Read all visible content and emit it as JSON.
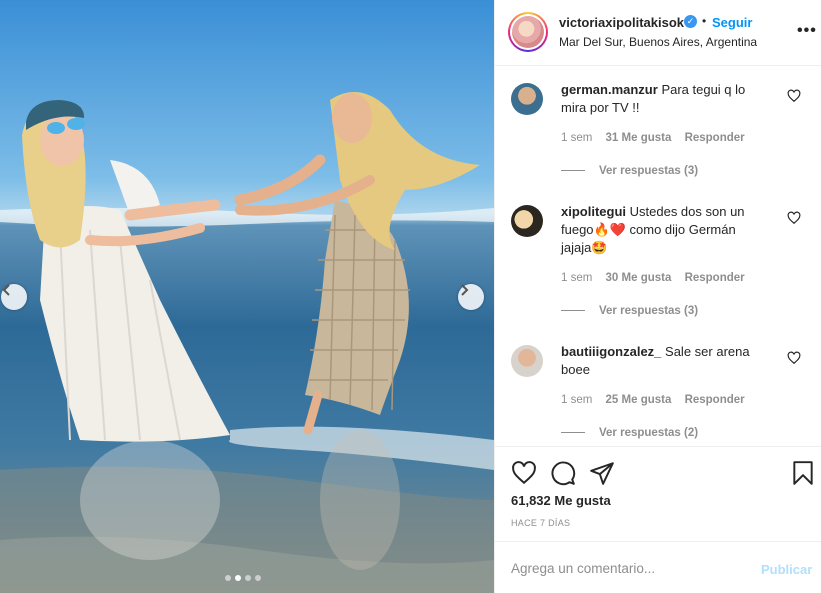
{
  "post": {
    "username": "victoriaxipolitakisok",
    "follow_label": "Seguir",
    "separator": "•",
    "location": "Mar Del Sur, Buenos Aires, Argentina",
    "more_icon": "•••",
    "likes": "61,832 Me gusta",
    "time_ago": "HACE 7 DÍAS",
    "carousel": {
      "total": 4,
      "active_index": 1
    }
  },
  "comments": [
    {
      "user": "german.manzur",
      "text": "Para tegui q lo mira por TV !!",
      "age": "1 sem",
      "likes": "31 Me gusta",
      "reply_label": "Responder",
      "replies_label": "Ver respuestas (3)"
    },
    {
      "user": "xipolitegui",
      "text": "Ustedes dos son un fuego🔥❤️ como dijo Germán jajaja🤩",
      "age": "1 sem",
      "likes": "30 Me gusta",
      "reply_label": "Responder",
      "replies_label": "Ver respuestas (3)"
    },
    {
      "user": "bautiiigonzalez_",
      "text": "Sale ser arena boee",
      "age": "1 sem",
      "likes": "25 Me gusta",
      "reply_label": "Responder",
      "replies_label": "Ver respuestas (2)"
    }
  ],
  "comment_box": {
    "placeholder": "Agrega un comentario...",
    "value": "",
    "publish_label": "Publicar"
  },
  "icons": {
    "verified": "✓",
    "heart": "heart-icon",
    "comment": "comment-icon",
    "share": "share-icon",
    "save": "bookmark-icon",
    "prev": "chevron-left-icon",
    "next": "chevron-right-icon"
  },
  "colors": {
    "accent": "#0095f6",
    "publish_disabled": "#b2dffc",
    "muted": "#8e8e8e",
    "verified": "#3897f0"
  }
}
